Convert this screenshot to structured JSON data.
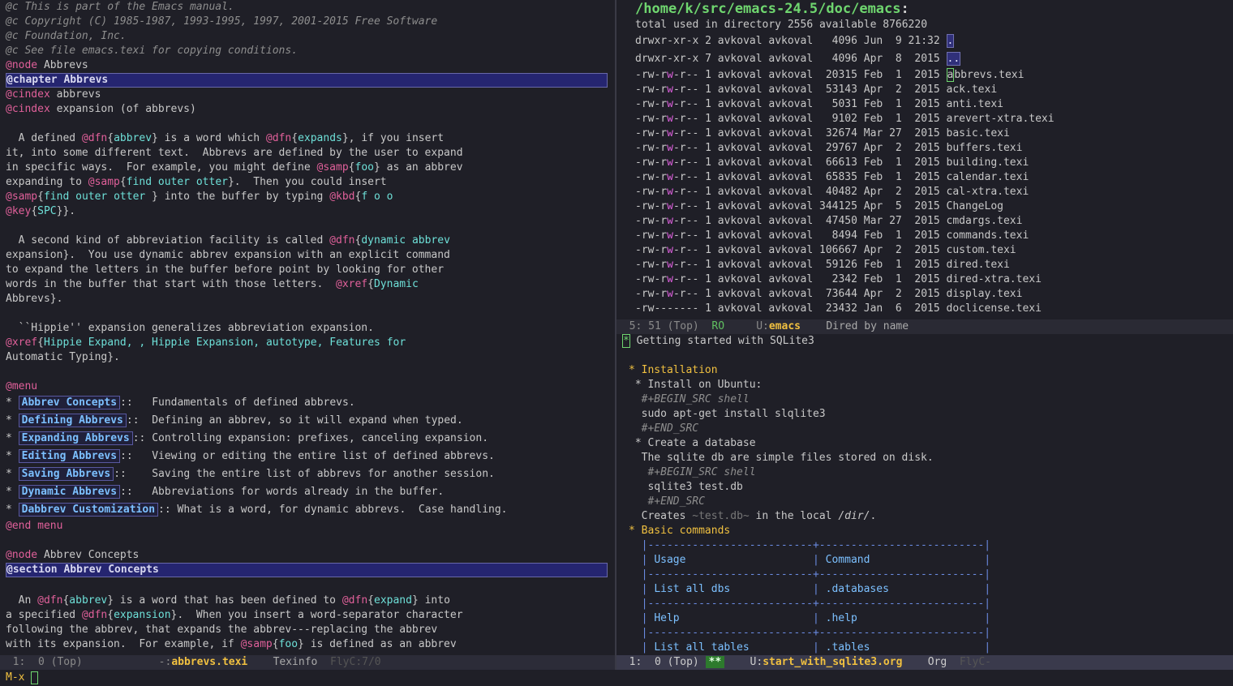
{
  "left": {
    "comments": [
      "@c This is part of the Emacs manual.",
      "@c Copyright (C) 1985-1987, 1993-1995, 1997, 2001-2015 Free Software",
      "@c Foundation, Inc.",
      "@c See file emacs.texi for copying conditions."
    ],
    "node1": "Abbrevs",
    "chapter": "@chapter Abbrevs",
    "cindex1": "abbrevs",
    "cindex2": "expansion (of abbrevs)",
    "p1": [
      "  A defined @dfn{abbrev} is a word which @dfn{expands}, if you insert",
      "it, into some different text.  Abbrevs are defined by the user to expand",
      "in specific ways.  For example, you might define @samp{foo} as an abbrev",
      "expanding to @samp{find outer otter}.  Then you could insert",
      "@samp{find outer otter } into the buffer by typing @kbd{f o o",
      "@key{SPC}}."
    ],
    "p2": [
      "  A second kind of abbreviation facility is called @dfn{dynamic abbrev",
      "expansion}.  You use dynamic abbrev expansion with an explicit command",
      "to expand the letters in the buffer before point by looking for other",
      "words in the buffer that start with those letters.  @xref{Dynamic",
      "Abbrevs}."
    ],
    "p3": [
      "  ``Hippie'' expansion generalizes abbreviation expansion.",
      "@xref{Hippie Expand, , Hippie Expansion, autotype, Features for",
      "Automatic Typing}."
    ],
    "menu_start": "menu",
    "menu_items": [
      {
        "link": "Abbrev Concepts",
        "sep": "::   ",
        "desc": "Fundamentals of defined abbrevs."
      },
      {
        "link": "Defining Abbrevs",
        "sep": "::  ",
        "desc": "Defining an abbrev, so it will expand when typed."
      },
      {
        "link": "Expanding Abbrevs",
        "sep": ":: ",
        "desc": "Controlling expansion: prefixes, canceling expansion."
      },
      {
        "link": "Editing Abbrevs",
        "sep": "::   ",
        "desc": "Viewing or editing the entire list of defined abbrevs."
      },
      {
        "link": "Saving Abbrevs",
        "sep": "::    ",
        "desc": "Saving the entire list of abbrevs for another session."
      },
      {
        "link": "Dynamic Abbrevs",
        "sep": "::   ",
        "desc": "Abbreviations for words already in the buffer."
      },
      {
        "link": "Dabbrev Customization",
        "sep": ":: ",
        "desc": "What is a word, for dynamic abbrevs.  Case handling."
      }
    ],
    "menu_end": "end menu",
    "node2": "Abbrev Concepts",
    "section": "@section Abbrev Concepts",
    "p4": [
      "  An @dfn{abbrev} is a word that has been defined to @dfn{expand} into",
      "a specified @dfn{expansion}.  When you insert a word-separator character",
      "following the abbrev, that expands the abbrev---replacing the abbrev",
      "with its expansion.  For example, if @samp{foo} is defined as an abbrev"
    ],
    "modeline": {
      "pos": "  1:  0 (Top)",
      "mod": "-:",
      "buffer": "abbrevs.texi",
      "mode": "Texinfo",
      "flyc": "FlyC:7/0"
    }
  },
  "dired": {
    "path": "/home/k/src/emacs-24.5/doc/emacs",
    "summary": "total used in directory 2556 available 8766220",
    "rows": [
      {
        "perm": "drwxr-xr-x",
        "n": "2",
        "owner": "avkoval",
        "group": "avkoval",
        "size": "4096",
        "mon": "Jun",
        "day": "9",
        "time": "21:32",
        "name": "."
      },
      {
        "perm": "drwxr-xr-x",
        "n": "7",
        "owner": "avkoval",
        "group": "avkoval",
        "size": "4096",
        "mon": "Apr",
        "day": "8",
        "time": "2015",
        "name": ".."
      },
      {
        "perm": "-rw-rw-r--",
        "n": "1",
        "owner": "avkoval",
        "group": "avkoval",
        "size": "20315",
        "mon": "Feb",
        "day": "1",
        "time": "2015",
        "name": "abbrevs.texi"
      },
      {
        "perm": "-rw-rw-r--",
        "n": "1",
        "owner": "avkoval",
        "group": "avkoval",
        "size": "53143",
        "mon": "Apr",
        "day": "2",
        "time": "2015",
        "name": "ack.texi"
      },
      {
        "perm": "-rw-rw-r--",
        "n": "1",
        "owner": "avkoval",
        "group": "avkoval",
        "size": "5031",
        "mon": "Feb",
        "day": "1",
        "time": "2015",
        "name": "anti.texi"
      },
      {
        "perm": "-rw-rw-r--",
        "n": "1",
        "owner": "avkoval",
        "group": "avkoval",
        "size": "9102",
        "mon": "Feb",
        "day": "1",
        "time": "2015",
        "name": "arevert-xtra.texi"
      },
      {
        "perm": "-rw-rw-r--",
        "n": "1",
        "owner": "avkoval",
        "group": "avkoval",
        "size": "32674",
        "mon": "Mar",
        "day": "27",
        "time": "2015",
        "name": "basic.texi"
      },
      {
        "perm": "-rw-rw-r--",
        "n": "1",
        "owner": "avkoval",
        "group": "avkoval",
        "size": "29767",
        "mon": "Apr",
        "day": "2",
        "time": "2015",
        "name": "buffers.texi"
      },
      {
        "perm": "-rw-rw-r--",
        "n": "1",
        "owner": "avkoval",
        "group": "avkoval",
        "size": "66613",
        "mon": "Feb",
        "day": "1",
        "time": "2015",
        "name": "building.texi"
      },
      {
        "perm": "-rw-rw-r--",
        "n": "1",
        "owner": "avkoval",
        "group": "avkoval",
        "size": "65835",
        "mon": "Feb",
        "day": "1",
        "time": "2015",
        "name": "calendar.texi"
      },
      {
        "perm": "-rw-rw-r--",
        "n": "1",
        "owner": "avkoval",
        "group": "avkoval",
        "size": "40482",
        "mon": "Apr",
        "day": "2",
        "time": "2015",
        "name": "cal-xtra.texi"
      },
      {
        "perm": "-rw-rw-r--",
        "n": "1",
        "owner": "avkoval",
        "group": "avkoval",
        "size": "344125",
        "mon": "Apr",
        "day": "5",
        "time": "2015",
        "name": "ChangeLog"
      },
      {
        "perm": "-rw-rw-r--",
        "n": "1",
        "owner": "avkoval",
        "group": "avkoval",
        "size": "47450",
        "mon": "Mar",
        "day": "27",
        "time": "2015",
        "name": "cmdargs.texi"
      },
      {
        "perm": "-rw-rw-r--",
        "n": "1",
        "owner": "avkoval",
        "group": "avkoval",
        "size": "8494",
        "mon": "Feb",
        "day": "1",
        "time": "2015",
        "name": "commands.texi"
      },
      {
        "perm": "-rw-rw-r--",
        "n": "1",
        "owner": "avkoval",
        "group": "avkoval",
        "size": "106667",
        "mon": "Apr",
        "day": "2",
        "time": "2015",
        "name": "custom.texi"
      },
      {
        "perm": "-rw-rw-r--",
        "n": "1",
        "owner": "avkoval",
        "group": "avkoval",
        "size": "59126",
        "mon": "Feb",
        "day": "1",
        "time": "2015",
        "name": "dired.texi"
      },
      {
        "perm": "-rw-rw-r--",
        "n": "1",
        "owner": "avkoval",
        "group": "avkoval",
        "size": "2342",
        "mon": "Feb",
        "day": "1",
        "time": "2015",
        "name": "dired-xtra.texi"
      },
      {
        "perm": "-rw-rw-r--",
        "n": "1",
        "owner": "avkoval",
        "group": "avkoval",
        "size": "73644",
        "mon": "Apr",
        "day": "2",
        "time": "2015",
        "name": "display.texi"
      },
      {
        "perm": "-rw-------",
        "n": "1",
        "owner": "avkoval",
        "group": "avkoval",
        "size": "23432",
        "mon": "Jan",
        "day": "6",
        "time": "2015",
        "name": "doclicense.texi"
      }
    ],
    "modeline": {
      "pos": "  5: 51 (Top)",
      "ro": "RO",
      "mod": "U:",
      "buffer": "emacs",
      "mode": "Dired by name"
    }
  },
  "org": {
    "title": "Getting started with SQLite3",
    "lines": {
      "h_install": "* Installation",
      "h_ubuntu": " * Install on Ubuntu:",
      "src1_begin": "  #+BEGIN_SRC shell",
      "src1_body": "  sudo apt-get install slqlite3",
      "src1_end": "  #+END_SRC",
      "h_create": " * Create a database",
      "create_text": "  The sqlite db are simple files stored on disk.",
      "src2_begin": "   #+BEGIN_SRC shell",
      "src2_body": "   sqlite3 test.db",
      "src2_end": "   #+END_SRC",
      "creates_pre": "  Creates ",
      "creates_code": "~test.db~",
      "creates_mid": " in the local ",
      "creates_dir": "/dir/",
      "creates_end": ".",
      "h_basic": "* Basic commands"
    },
    "table": {
      "sep": "  |--------------------------+--------------------------|",
      "header": [
        "Usage",
        "Command"
      ],
      "rows": [
        [
          "List all dbs",
          ".databases"
        ],
        [
          "Help",
          ".help"
        ],
        [
          "List all tables",
          ".tables"
        ]
      ]
    },
    "modeline": {
      "pos": "  1:  0 (Top)",
      "stars": "**",
      "mod": "U:",
      "buffer": "start_with_sqlite3.org",
      "mode": "Org",
      "flyc": "FlyC-"
    }
  },
  "minibuffer": {
    "prompt": "M-x"
  }
}
